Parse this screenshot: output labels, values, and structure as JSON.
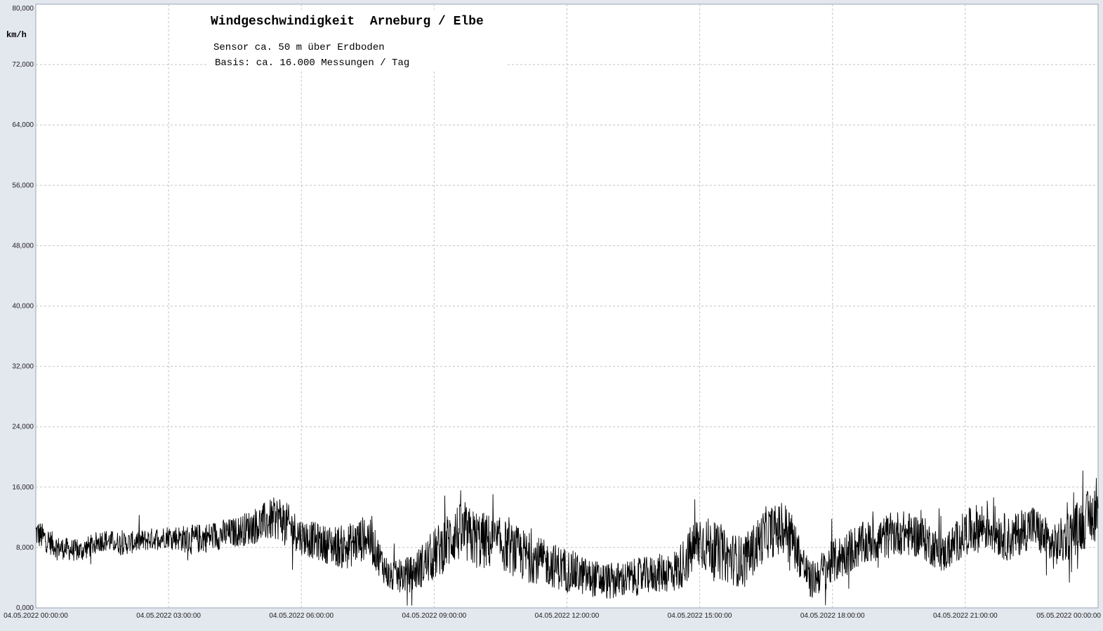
{
  "chart_data": {
    "type": "line",
    "title": "Windgeschwindigkeit  Arneburg / Elbe",
    "subtitle_lines": [
      "Sensor ca. 50 m über Erdboden",
      "Basis: ca. 16.000 Messungen / Tag"
    ],
    "ylabel": "km/h",
    "xlabel": "",
    "ylim": [
      0,
      80
    ],
    "y_ticks": [
      0,
      8,
      16,
      24,
      32,
      40,
      48,
      56,
      64,
      72,
      80
    ],
    "y_tick_labels": [
      "0,000",
      "8,000",
      "16,000",
      "24,000",
      "32,000",
      "40,000",
      "48,000",
      "56,000",
      "64,000",
      "72,000",
      "80,000"
    ],
    "xlim_hours": [
      0,
      24
    ],
    "x_ticks_hours": [
      0,
      3,
      6,
      9,
      12,
      15,
      18,
      21,
      24
    ],
    "x_tick_labels": [
      "04.05.2022  00:00:00",
      "04.05.2022  03:00:00",
      "04.05.2022  06:00:00",
      "04.05.2022  09:00:00",
      "04.05.2022  12:00:00",
      "04.05.2022  15:00:00",
      "04.05.2022  18:00:00",
      "04.05.2022  21:00:00",
      "05.05.2022  00:00:00"
    ],
    "grid": true,
    "line_color": "#000000",
    "series": [
      {
        "x_hours": [
          0,
          0.5,
          1,
          1.5,
          2,
          2.5,
          3,
          3.5,
          4,
          4.5,
          5,
          5.5,
          6,
          6.5,
          7,
          7.5,
          8,
          8.5,
          9,
          9.5,
          10,
          10.5,
          11,
          11.5,
          12,
          12.5,
          13,
          13.5,
          14,
          14.5,
          15,
          15.5,
          16,
          16.5,
          17,
          17.5,
          18,
          18.5,
          19,
          19.5,
          20,
          20.5,
          21,
          21.5,
          22,
          22.5,
          23,
          23.5,
          24
        ],
        "values": [
          10,
          8,
          7.5,
          9,
          8.5,
          9,
          9.5,
          9,
          9.5,
          10,
          11,
          12,
          9.5,
          8.5,
          8,
          9.5,
          4,
          4.5,
          7,
          10,
          9,
          8.5,
          7,
          6,
          5,
          4,
          3.5,
          4,
          4.5,
          5,
          9,
          7,
          6,
          10,
          10.5,
          3.5,
          6,
          8,
          9,
          10,
          9.5,
          7,
          10,
          11,
          9,
          11,
          8,
          10.5,
          13
        ],
        "amplitude": [
          2,
          1.5,
          1.5,
          1.5,
          1.5,
          1.5,
          1.5,
          2,
          2,
          2,
          2.5,
          3,
          2.5,
          2.5,
          3,
          3,
          2,
          2.5,
          3.5,
          4,
          4,
          3.5,
          3.5,
          3,
          3,
          2.5,
          2.5,
          2.5,
          2.5,
          3,
          4,
          3.5,
          3.5,
          3.5,
          3.5,
          2.5,
          3,
          3,
          3,
          3,
          3,
          2.5,
          3,
          3.5,
          3,
          3,
          3,
          3.5,
          4
        ]
      }
    ]
  }
}
